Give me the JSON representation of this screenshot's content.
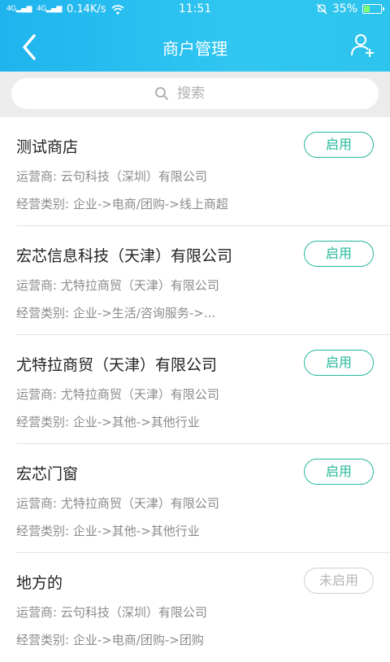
{
  "status_bar": {
    "network_speed": "0.14K/s",
    "signal_1": "4G",
    "signal_2": "4G",
    "time": "11:51",
    "battery_percent": "35%",
    "battery_level": 0.35
  },
  "nav": {
    "title": "商户管理",
    "back_icon": "chevron-left-icon",
    "add_icon": "add-user-icon"
  },
  "search": {
    "placeholder": "搜索"
  },
  "colors": {
    "header_start": "#1fb4ee",
    "header_end": "#2dc4ee",
    "enabled_accent": "#27b89b",
    "disabled_gray": "#b5b5b5"
  },
  "merchants": [
    {
      "name": "测试商店",
      "operator": "运营商: 云句科技（深圳）有限公司",
      "category": "经营类别: 企业->电商/团购->线上商超",
      "status": "启用",
      "enabled": true
    },
    {
      "name": "宏芯信息科技（天津）有限公司",
      "operator": "运营商: 尤特拉商贸（天津）有限公司",
      "category": "经营类别: 企业->生活/咨询服务->...",
      "status": "启用",
      "enabled": true
    },
    {
      "name": "尤特拉商贸（天津）有限公司",
      "operator": "运营商: 尤特拉商贸（天津）有限公司",
      "category": "经营类别: 企业->其他->其他行业",
      "status": "启用",
      "enabled": true
    },
    {
      "name": "宏芯门窗",
      "operator": "运营商: 尤特拉商贸（天津）有限公司",
      "category": "经营类别: 企业->其他->其他行业",
      "status": "启用",
      "enabled": true
    },
    {
      "name": "地方的",
      "operator": "运营商: 云句科技（深圳）有限公司",
      "category": "经营类别: 企业->电商/团购->团购",
      "status": "未启用",
      "enabled": false
    }
  ]
}
